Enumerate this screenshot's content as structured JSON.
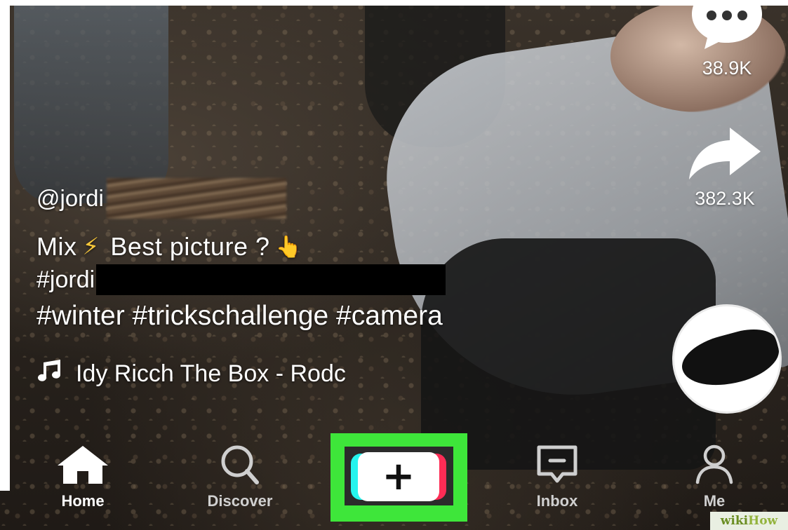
{
  "actions": {
    "comment_count": "38.9K",
    "share_count": "382.3K"
  },
  "caption": {
    "username": "@jordi",
    "description_prefix": "Mix",
    "description_emoji": "⚡",
    "description_text": "Best picture ?",
    "pointing_emoji": "👆",
    "hashtag_line1": "#jordi",
    "hashtag_line2": "#winter #trickschallenge #camera",
    "music": "Idy Ricch   The Box - Rodc"
  },
  "nav": {
    "home": "Home",
    "discover": "Discover",
    "create_symbol": "+",
    "inbox": "Inbox",
    "me": "Me"
  },
  "watermark": {
    "part1": "wiki",
    "part2": "How"
  },
  "colors": {
    "highlight": "#3ee63a",
    "cyan": "#25f4ee",
    "red": "#fe2c55"
  },
  "icons": [
    "comment-icon",
    "share-icon",
    "music-note-icon",
    "home-icon",
    "search-icon",
    "inbox-icon",
    "profile-icon",
    "plus-icon"
  ]
}
